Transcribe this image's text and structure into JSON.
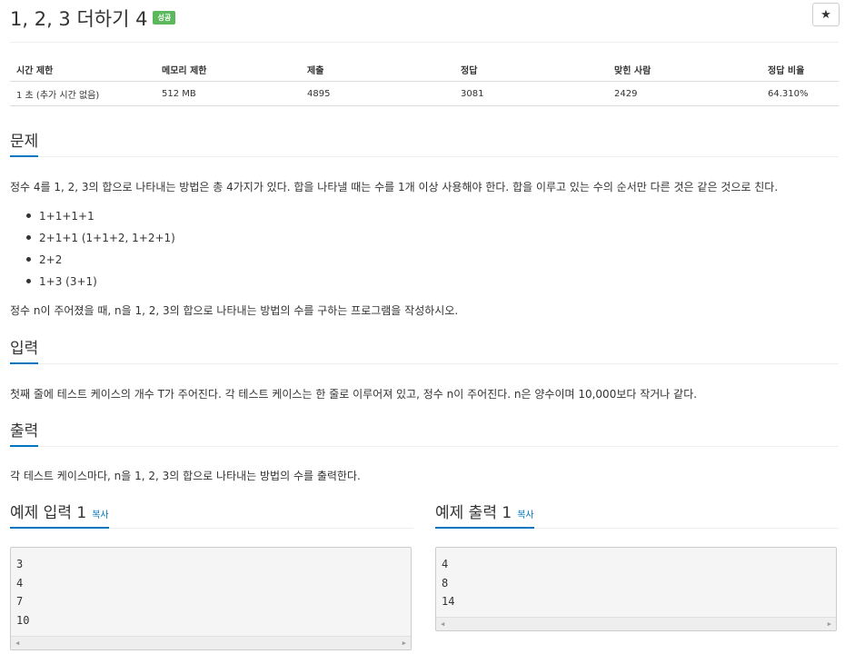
{
  "problem": {
    "title": "1, 2, 3 더하기 4",
    "badge": "성공",
    "star_button": "★"
  },
  "info": {
    "headers": [
      "시간 제한",
      "메모리 제한",
      "제출",
      "정답",
      "맞힌 사람",
      "정답 비율"
    ],
    "values": [
      "1 초 (추가 시간 없음)",
      "512 MB",
      "4895",
      "3081",
      "2429",
      "64.310%"
    ]
  },
  "sections": {
    "problem_header": "문제",
    "problem_text": "정수 4를 1, 2, 3의 합으로 나타내는 방법은 총 4가지가 있다. 합을 나타낼 때는 수를 1개 이상 사용해야 한다. 합을 이루고 있는 수의 순서만 다른 것은 같은 것으로 친다.",
    "examples": [
      "1+1+1+1",
      "2+1+1 (1+1+2, 1+2+1)",
      "2+2",
      "1+3 (3+1)"
    ],
    "problem_text2": "정수 n이 주어졌을 때, n을 1, 2, 3의 합으로 나타내는 방법의 수를 구하는 프로그램을 작성하시오.",
    "input_header": "입력",
    "input_text": "첫째 줄에 테스트 케이스의 개수 T가 주어진다. 각 테스트 케이스는 한 줄로 이루어져 있고, 정수 n이 주어진다. n은 양수이며 10,000보다 작거나 같다.",
    "output_header": "출력",
    "output_text": "각 테스트 케이스마다, n을 1, 2, 3의 합으로 나타내는 방법의 수를 출력한다."
  },
  "samples": {
    "input_title": "예제 입력 1",
    "output_title": "예제 출력 1",
    "copy_label": "복사",
    "input_lines": [
      "3",
      "4",
      "7",
      "10"
    ],
    "output_lines": [
      "4",
      "8",
      "14"
    ]
  },
  "colors": {
    "accent": "#0076c0",
    "badge": "#5cb85c"
  }
}
